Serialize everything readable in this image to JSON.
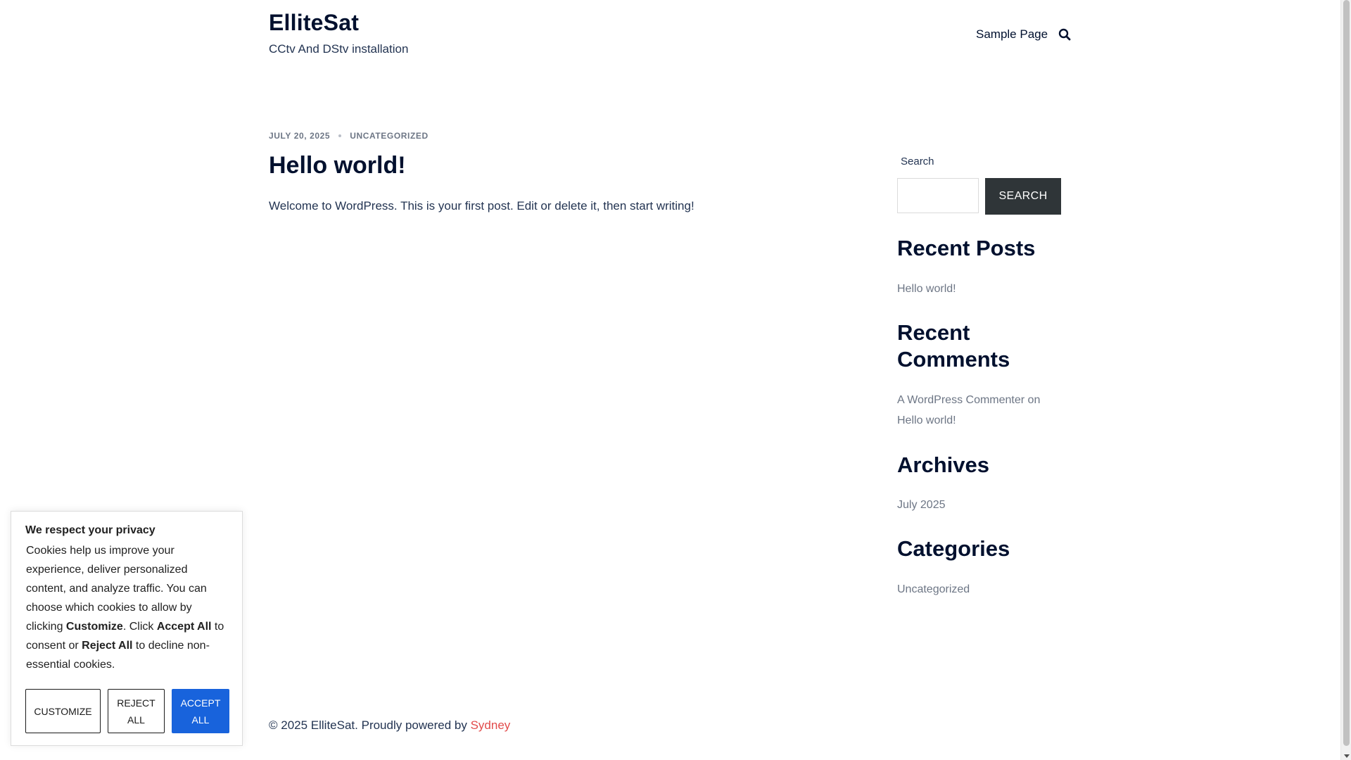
{
  "header": {
    "site_title": "ElliteSat",
    "site_description": "CCtv And DStv installation",
    "nav_items": [
      "Sample Page"
    ],
    "search_icon": "search-icon"
  },
  "post": {
    "date": "JULY 20, 2025",
    "category": "UNCATEGORIZED",
    "title": "Hello world!",
    "excerpt": "Welcome to WordPress. This is your first post. Edit or delete it, then start writing!"
  },
  "sidebar": {
    "search_label": "Search",
    "search_value": "",
    "search_button": "SEARCH",
    "recent_posts": {
      "title": "Recent Posts",
      "items": [
        "Hello world!"
      ]
    },
    "recent_comments": {
      "title": "Recent Comments",
      "author": "A WordPress Commenter",
      "connector": " on ",
      "post": "Hello world!"
    },
    "archives": {
      "title": "Archives",
      "items": [
        "July 2025"
      ]
    },
    "categories": {
      "title": "Categories",
      "items": [
        "Uncategorized"
      ]
    }
  },
  "footer": {
    "text": "© 2025 ElliteSat. Proudly powered by ",
    "link": "Sydney"
  },
  "cookie_banner": {
    "title": "We respect your privacy",
    "text_1": "Cookies help us improve your experience, deliver personalized content, and analyze traffic. You can choose which cookies to allow by clicking ",
    "bold_customize": "Customize",
    "text_2": ". Click ",
    "bold_accept": "Accept All",
    "text_3": " to consent or ",
    "bold_reject": "Reject All",
    "text_4": " to decline non-essential cookies.",
    "customize_label": "CUSTOMIZE",
    "reject_label": "REJECT ALL",
    "accept_label": "ACCEPT ALL"
  },
  "colors": {
    "heading": "#00102e",
    "body_text": "#233452",
    "muted": "#6d7685",
    "accent_link": "#e24b4b",
    "accept_button": "#1863dc",
    "search_button": "#2f3538"
  }
}
